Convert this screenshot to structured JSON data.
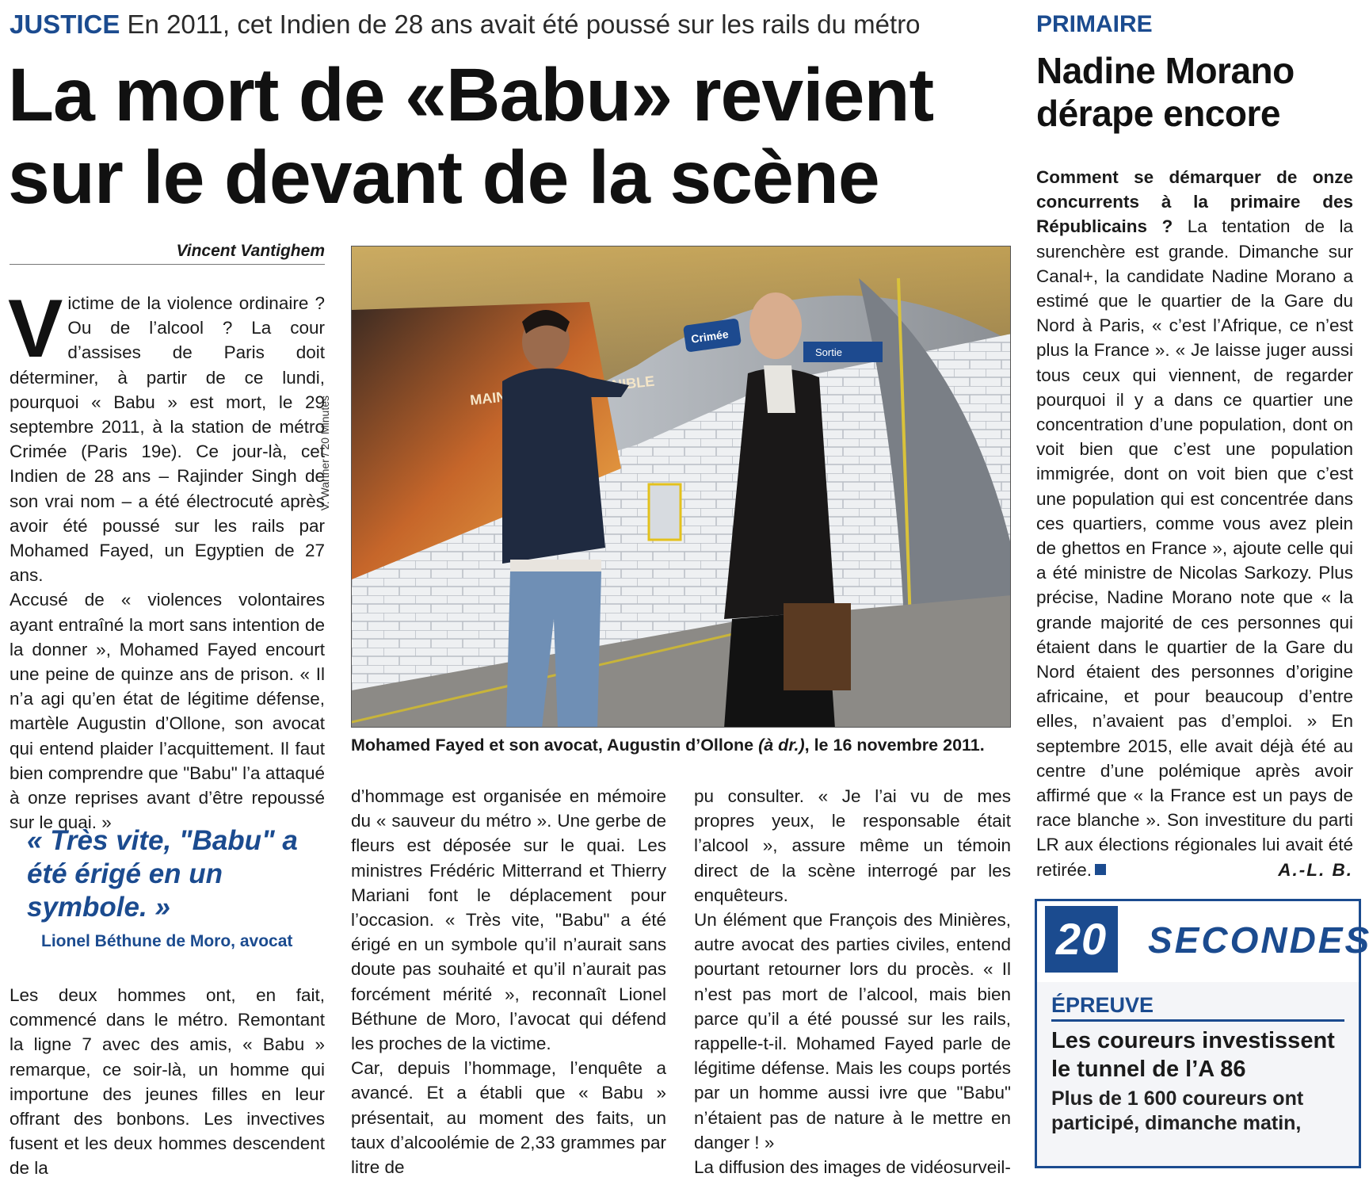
{
  "kicker": {
    "tag": "JUSTICE",
    "text": "En 2011, cet Indien de 28 ans avait été poussé sur les rails du métro"
  },
  "headline": {
    "line1": "La mort de «Babu» revient",
    "line2": "sur le devant de la scène"
  },
  "byline": "Vincent Vantighem",
  "article": {
    "dropcap": "V",
    "col1_paragraphs": [
      "ictime de la violence ordinaire ? Ou de l’alcool ? La cour d’assises de Paris doit déterminer, à partir de ce lundi, pourquoi « Babu » est mort, le 29 septembre 2011, à la station de métro Crimée (Paris 19e). Ce jour-là, cet Indien de 28 ans – Rajinder Singh de son vrai nom – a été électrocuté après avoir été poussé sur les rails par Mohamed Fayed, un Egyptien de 27 ans.",
      "Accusé de « violences volontaires ayant entraîné la mort sans intention de la donner », Mohamed Fayed encourt une peine de quinze ans de prison. « Il n’a agi qu’en état de légitime défense, martèle Augustin d’Ollone, son avocat qui entend plaider l’acquittement. Il faut bien comprendre que \"Babu\" l’a attaqué à onze reprises avant d’être repoussé sur le quai. »"
    ],
    "quote": "« Très vite, \"Babu\" a été érigé en un symbole. »",
    "quote_author": "Lionel Béthune de Moro, avocat",
    "col1b_paragraphs": [
      "Les deux hommes ont, en fait, commencé dans le métro. Remontant la ligne 7 avec des amis, « Babu » remarque, ce soir-là, un homme qui importune des jeunes filles en leur offrant des bonbons. Les invectives fusent et les deux hommes descendent de la"
    ],
    "col2_paragraphs": [
      "d’hommage est organisée en mémoire du « sauveur du métro ». Une gerbe de fleurs est déposée sur le quai. Les ministres Frédéric Mitterrand et Thierry Mariani font le déplacement pour l’occasion. « Très vite, \"Babu\" a été érigé en un symbole qu’il n’aurait sans doute pas souhaité et qu’il n’aurait pas forcément mérité », reconnaît Lionel Béthune de Moro, l’avocat qui défend les proches de la victime.",
      "Car, depuis l’hommage, l’enquête a avancé. Et a établi que « Babu » présentait, au moment des faits, un taux d’alcoolémie de 2,33 grammes par litre de"
    ],
    "col3_paragraphs": [
      "pu consulter. « Je l’ai vu de mes propres yeux, le responsable était l’alcool », assure même un témoin direct de la scène interrogé par les enquêteurs.",
      "Un élément que François des Minières, autre avocat des parties civiles, entend pourtant retourner lors du procès. « Il n’est pas mort de l’alcool, mais bien parce qu’il a été poussé sur les rails, rappelle-t-il. Mohamed Fayed parle de légitime défense. Mais les coups portés par un homme aussi ivre que \"Babu\" n’étaient pas de nature à le mettre en danger ! »",
      "La diffusion des images de vidéosurveil-"
    ]
  },
  "photo": {
    "credit": "V. Wartner / 20 Minutes",
    "station_sign": "Crimée",
    "direction_sign": "Sortie",
    "poster_text": "MAINTENANT DISPONIBLE",
    "caption_a": "Mohamed Fayed et son avocat, Augustin d’Ollone ",
    "caption_b": "(à dr.)",
    "caption_c": ", le 16 novembre 2011."
  },
  "sidebar": {
    "tag": "PRIMAIRE",
    "title": "Nadine Morano dérape encore",
    "lead": "Comment se démarquer de onze concurrents à la primaire des Républicains ?",
    "body": " La tentation de la surenchère est grande. Dimanche sur Canal+, la candidate Nadine Morano a estimé que le quartier de la Gare du Nord à Paris, « c’est l’Afrique, ce n’est plus la France ». « Je laisse juger aussi tous ceux qui viennent, de regarder pourquoi il y a dans ce quartier une concentration d’une population, dont on voit bien que c’est une population immigrée, dont on voit bien que c’est une population qui est concentrée dans ces quartiers, comme vous avez plein de ghettos en France », ajoute celle qui a été ministre de Nicolas Sarkozy. Plus précise, Nadine Morano note que « la grande majorité de ces personnes qui étaient dans le quartier de la Gare du Nord étaient des personnes d’origine africaine, et pour beaucoup d’entre elles, n’avaient pas d’emploi. » En septembre 2015, elle avait déjà été au centre d’une polémique après avoir affirmé que « la France est un pays de race blanche ». Son investiture du parti LR aux élections régionales lui avait été retirée.",
    "signature": "A.-L. B."
  },
  "box": {
    "number": "20",
    "word": "SECONDES",
    "tag": "ÉPREUVE",
    "title": "Les coureurs investissent le tunnel de l’A 86",
    "text": "Plus de 1 600 coureurs ont participé, dimanche matin,"
  },
  "colors": {
    "accent": "#1b4b8f",
    "text": "#1a1a1a"
  }
}
